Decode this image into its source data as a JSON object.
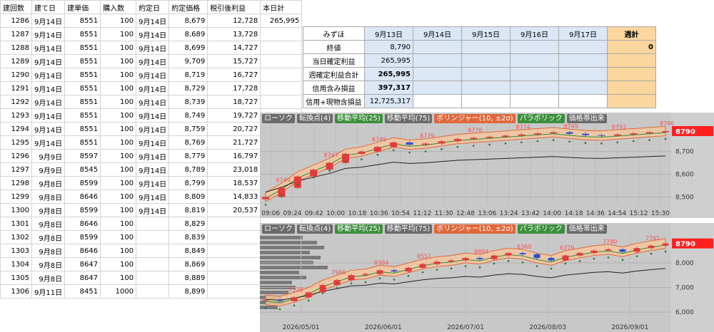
{
  "sheet": {
    "headers": [
      "建回数",
      "建て日",
      "建単価",
      "購入数",
      "約定日",
      "約定価格",
      "税引後利益",
      "本日計"
    ],
    "rows": [
      [
        "1286",
        "9月14日",
        "8551",
        "100",
        "9月14日",
        "8,679",
        "12,728"
      ],
      [
        "1287",
        "9月14日",
        "8551",
        "100",
        "9月14日",
        "8,689",
        "13,728"
      ],
      [
        "1288",
        "9月14日",
        "8551",
        "100",
        "9月14日",
        "8,699",
        "14,727"
      ],
      [
        "1289",
        "9月14日",
        "8551",
        "100",
        "9月14日",
        "9,709",
        "15,727"
      ],
      [
        "1290",
        "9月14日",
        "8551",
        "100",
        "9月14日",
        "8,719",
        "16,727"
      ],
      [
        "1291",
        "9月14日",
        "8551",
        "100",
        "9月14日",
        "8,729",
        "17,728"
      ],
      [
        "1292",
        "9月14日",
        "8551",
        "100",
        "9月14日",
        "8,739",
        "18,727"
      ],
      [
        "1293",
        "9月14日",
        "8551",
        "100",
        "9月14日",
        "8,749",
        "19,727"
      ],
      [
        "1294",
        "9月14日",
        "8551",
        "100",
        "9月14日",
        "8,759",
        "20,727"
      ],
      [
        "1295",
        "9月14日",
        "8551",
        "100",
        "9月14日",
        "8,769",
        "21,727"
      ],
      [
        "1296",
        "9月9日",
        "8597",
        "100",
        "9月14日",
        "8,779",
        "16,797"
      ],
      [
        "1297",
        "9月9日",
        "8545",
        "100",
        "9月14日",
        "8,789",
        "23,018"
      ],
      [
        "1298",
        "9月8日",
        "8599",
        "100",
        "9月14日",
        "8,799",
        "18,537"
      ],
      [
        "1299",
        "9月8日",
        "8646",
        "100",
        "9月14日",
        "8,809",
        "14,833"
      ],
      [
        "1300",
        "9月8日",
        "8599",
        "100",
        "9月14日",
        "8,819",
        "20,537"
      ],
      [
        "1301",
        "9月8日",
        "8646",
        "100",
        "",
        "8,829",
        ""
      ],
      [
        "1302",
        "9月8日",
        "8599",
        "100",
        "",
        "8,839",
        ""
      ],
      [
        "1303",
        "9月8日",
        "8646",
        "100",
        "",
        "8,849",
        ""
      ],
      [
        "1304",
        "9月8日",
        "8647",
        "100",
        "",
        "8,869",
        ""
      ],
      [
        "1305",
        "9月8日",
        "8647",
        "100",
        "",
        "8,889",
        ""
      ],
      [
        "1306",
        "9月11日",
        "8451",
        "1000",
        "",
        "8,899",
        ""
      ]
    ],
    "today_total": "265,995"
  },
  "summary": {
    "corner": "みずほ",
    "dates": [
      "9月13日",
      "9月14日",
      "9月15日",
      "9月16日",
      "9月17日"
    ],
    "weekly_header": "週計",
    "rows": [
      {
        "label": "終値",
        "value": "8,790",
        "bold": false,
        "weekly": "0"
      },
      {
        "label": "当日確定利益",
        "value": "265,995",
        "bold": false,
        "weekly": ""
      },
      {
        "label": "週確定利益合計",
        "value": "265,995",
        "bold": true,
        "weekly": ""
      },
      {
        "label": "信用含み損益",
        "value": "397,317",
        "bold": true,
        "weekly": ""
      },
      {
        "label": "信用+現物含損益",
        "value": "12,725,317",
        "bold": false,
        "weekly": ""
      }
    ]
  },
  "chart_toolbar": [
    "ローソク",
    "転換点(4)",
    "移動平均(25)",
    "移動平均(75)",
    "ボリンジャー(10, ±2σ)",
    "パラボリック",
    "価格帯出来"
  ],
  "chart_toolbar_colors": [
    "#6b6b6b",
    "#6b6b6b",
    "#3c8f3c",
    "#6b6b6b",
    "#e0683b",
    "#3c8f3c",
    "#6b6b6b"
  ],
  "chart_data": [
    {
      "type": "candlestick",
      "xlabels": [
        "09:06",
        "09:24",
        "09:42",
        "10:00",
        "10:18",
        "10:36",
        "10:54",
        "11:12",
        "11:30",
        "12:48",
        "13:06",
        "13:24",
        "13:42",
        "14:00",
        "14:18",
        "14:36",
        "14:54",
        "15:12",
        "15:30"
      ],
      "yticks": [
        "8,700",
        "8,600",
        "8,500"
      ],
      "ylim": [
        8470,
        8815
      ],
      "last_price": "8790",
      "price_labels": [
        "8749",
        "8747",
        "8749",
        "8779",
        "8776",
        "8774",
        "8749",
        "8793",
        "8790"
      ],
      "close": [
        8500,
        8540,
        8590,
        8620,
        8650,
        8690,
        8700,
        8720,
        8740,
        8730,
        8735,
        8745,
        8755,
        8760,
        8765,
        8770,
        8775,
        8780,
        8785,
        8778,
        8772,
        8770,
        8775,
        8780,
        8785,
        8790
      ]
    },
    {
      "type": "candlestick",
      "xlabels": [
        "2026/05/01",
        "2026/06/01",
        "2026/07/01",
        "2026/08/03",
        "2026/09/01"
      ],
      "yticks": [
        "8,000",
        "7,000",
        "6,000"
      ],
      "ylim": [
        5800,
        9100
      ],
      "last_price": "8790",
      "price_labels": [
        "7528",
        "7966",
        "8304",
        "8551",
        "8894",
        "6360",
        "6379",
        "7790",
        "7761"
      ],
      "close": [
        6500,
        6450,
        6600,
        6800,
        7100,
        7300,
        7500,
        7550,
        7700,
        7650,
        7800,
        7950,
        8050,
        8100,
        8200,
        8150,
        8300,
        8400,
        8350,
        8200,
        8100,
        8300,
        8400,
        8500,
        8550,
        8450,
        8600,
        8700,
        8790
      ]
    }
  ]
}
